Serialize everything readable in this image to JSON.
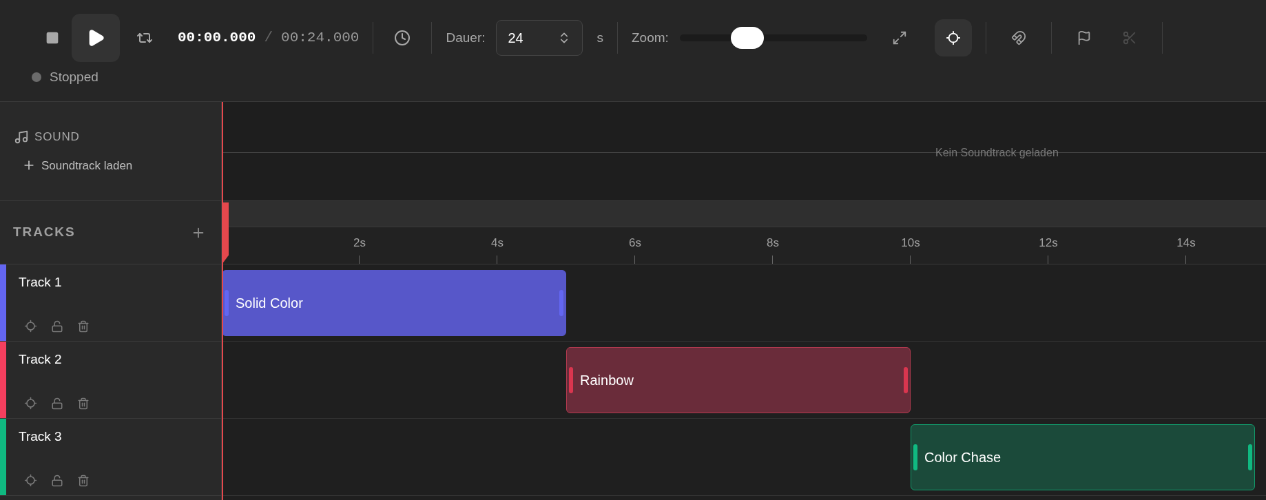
{
  "transport": {
    "current_time": "00:00.000",
    "separator": "/",
    "total_time": "00:24.000",
    "play_selected": true
  },
  "duration": {
    "label": "Dauer:",
    "value": "24",
    "unit": "s"
  },
  "zoom": {
    "label": "Zoom:",
    "level": 0.36
  },
  "tools": [
    {
      "kind": "fit",
      "selected": false,
      "disabled": false
    },
    {
      "kind": "target",
      "selected": true,
      "disabled": false
    },
    {
      "kind": "snap",
      "selected": false,
      "disabled": false
    },
    {
      "kind": "marker",
      "selected": false,
      "disabled": false
    },
    {
      "kind": "cut",
      "selected": false,
      "disabled": true
    }
  ],
  "status": {
    "label": "Stopped",
    "color": "#6b6b6b"
  },
  "sound": {
    "title": "SOUND",
    "load_label": "Soundtrack laden",
    "empty_message": "Kein Soundtrack geladen"
  },
  "tracks_header": {
    "title": "TRACKS"
  },
  "ruler": {
    "ticks": [
      "2s",
      "4s",
      "6s",
      "8s",
      "10s",
      "12s",
      "14s"
    ]
  },
  "tracks": [
    {
      "name": "Track 1",
      "color": "#6366f1",
      "clip": {
        "label": "Solid Color",
        "kind": "solid"
      }
    },
    {
      "name": "Track 2",
      "color": "#f43f5e",
      "clip": {
        "label": "Rainbow",
        "kind": "rainbow"
      }
    },
    {
      "name": "Track 3",
      "color": "#10b981",
      "clip": {
        "label": "Color Chase",
        "kind": "chase"
      }
    }
  ]
}
